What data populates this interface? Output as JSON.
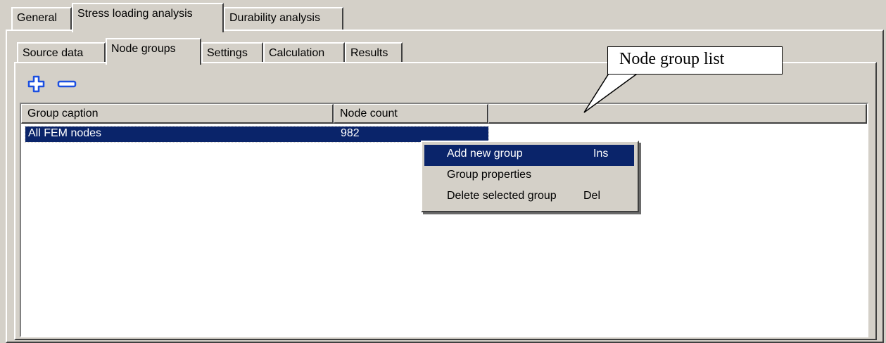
{
  "outer_tabs": [
    "General",
    "Stress loading analysis",
    "Durability analysis"
  ],
  "inner_tabs": [
    "Source data",
    "Node groups",
    "Settings",
    "Calculation",
    "Results"
  ],
  "toolbar": {
    "add_icon": "plus-icon",
    "remove_icon": "minus-icon"
  },
  "table": {
    "columns": [
      "Group caption",
      "Node count"
    ],
    "rows": [
      {
        "caption": "All FEM nodes",
        "count": "982"
      }
    ]
  },
  "context_menu": {
    "items": [
      {
        "label": "Add new group",
        "shortcut": "Ins"
      },
      {
        "label": "Group properties",
        "shortcut": ""
      },
      {
        "label": "Delete selected group",
        "shortcut": "Del"
      }
    ]
  },
  "callout": {
    "text": "Node group list"
  },
  "colors": {
    "face": "#d4d0c8",
    "selection": "#0a246a",
    "icon": "#1b4fe0"
  }
}
